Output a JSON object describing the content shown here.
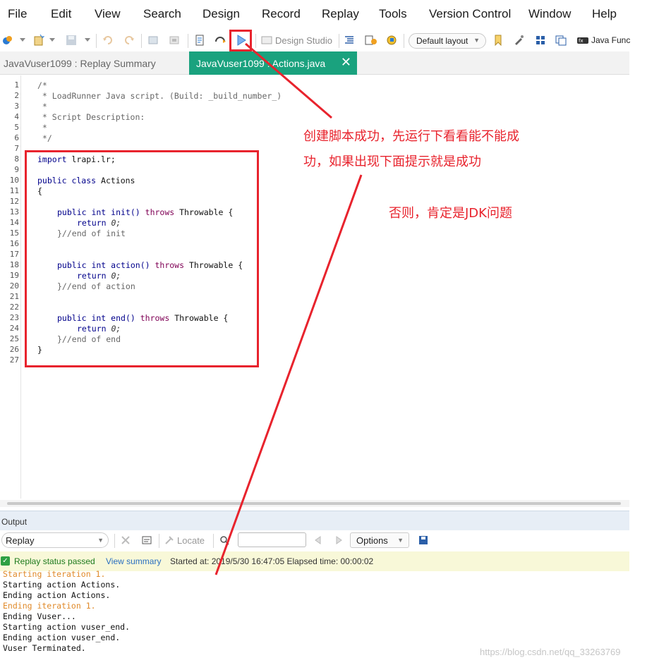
{
  "menu": [
    "File",
    "Edit",
    "View",
    "Search",
    "Design",
    "Record",
    "Replay",
    "Tools",
    "Version Control",
    "Window",
    "Help"
  ],
  "toolbar": {
    "design_studio": "Design Studio",
    "layout": "Default layout",
    "java_functions": "Java Func"
  },
  "tabs": {
    "summary": "JavaVuser1099 : Replay Summary",
    "actions": "JavaVuser1099 : Actions.java"
  },
  "code_lines": [
    "1",
    "2",
    "3",
    "4",
    "5",
    "6",
    "7",
    "8",
    "9",
    "10",
    "11",
    "12",
    "13",
    "14",
    "15",
    "16",
    "17",
    "18",
    "19",
    "20",
    "21",
    "22",
    "23",
    "24",
    "25",
    "26",
    "27"
  ],
  "code": {
    "l1": "/*",
    "l2": " * LoadRunner Java script. (Build: _build_number_)",
    "l3": " *",
    "l4": " * Script Description:",
    "l5": " *",
    "l6": " */",
    "l8_kw": "import",
    "l8_rest": " lrapi.lr;",
    "l10_kw": "public class",
    "l10_rest": " Actions",
    "l11": "{",
    "init_kw": "public int",
    "init_name": " init()",
    "throws": " throws",
    "throwable": " Throwable {",
    "return_kw": "return",
    "zero": " 0;",
    "end_init": "}//end of init",
    "action_name": " action()",
    "end_action": "}//end of action",
    "end_name": " end()",
    "end_end": "}//end of end",
    "close": "}"
  },
  "output": {
    "title": "Output",
    "replay_select": "Replay",
    "locate": "Locate",
    "options": "Options",
    "status_passed": "Replay status passed",
    "view_summary": "View summary",
    "started": "Started at: 2019/5/30 16:47:05 Elapsed time: 00:00:02",
    "log": [
      {
        "text": "Starting iteration 1.",
        "orange": true
      },
      {
        "text": "Starting action Actions.",
        "orange": false
      },
      {
        "text": "Ending action Actions.",
        "orange": false
      },
      {
        "text": "Ending iteration 1.",
        "orange": true
      },
      {
        "text": "Ending Vuser...",
        "orange": false
      },
      {
        "text": "Starting action vuser_end.",
        "orange": false
      },
      {
        "text": "Ending action vuser_end.",
        "orange": false
      },
      {
        "text": "Vuser Terminated.",
        "orange": false
      }
    ]
  },
  "annotations": {
    "line1": "创建脚本成功，先运行下看看能不能成",
    "line2": "功，如果出现下面提示就是成功",
    "line3": "否则，肯定是JDK问题"
  },
  "watermark": "https://blog.csdn.net/qq_33263769",
  "colors": {
    "tab_active": "#1aa27e",
    "annotation": "#e8232d",
    "status_bg": "#f8f8d8"
  }
}
